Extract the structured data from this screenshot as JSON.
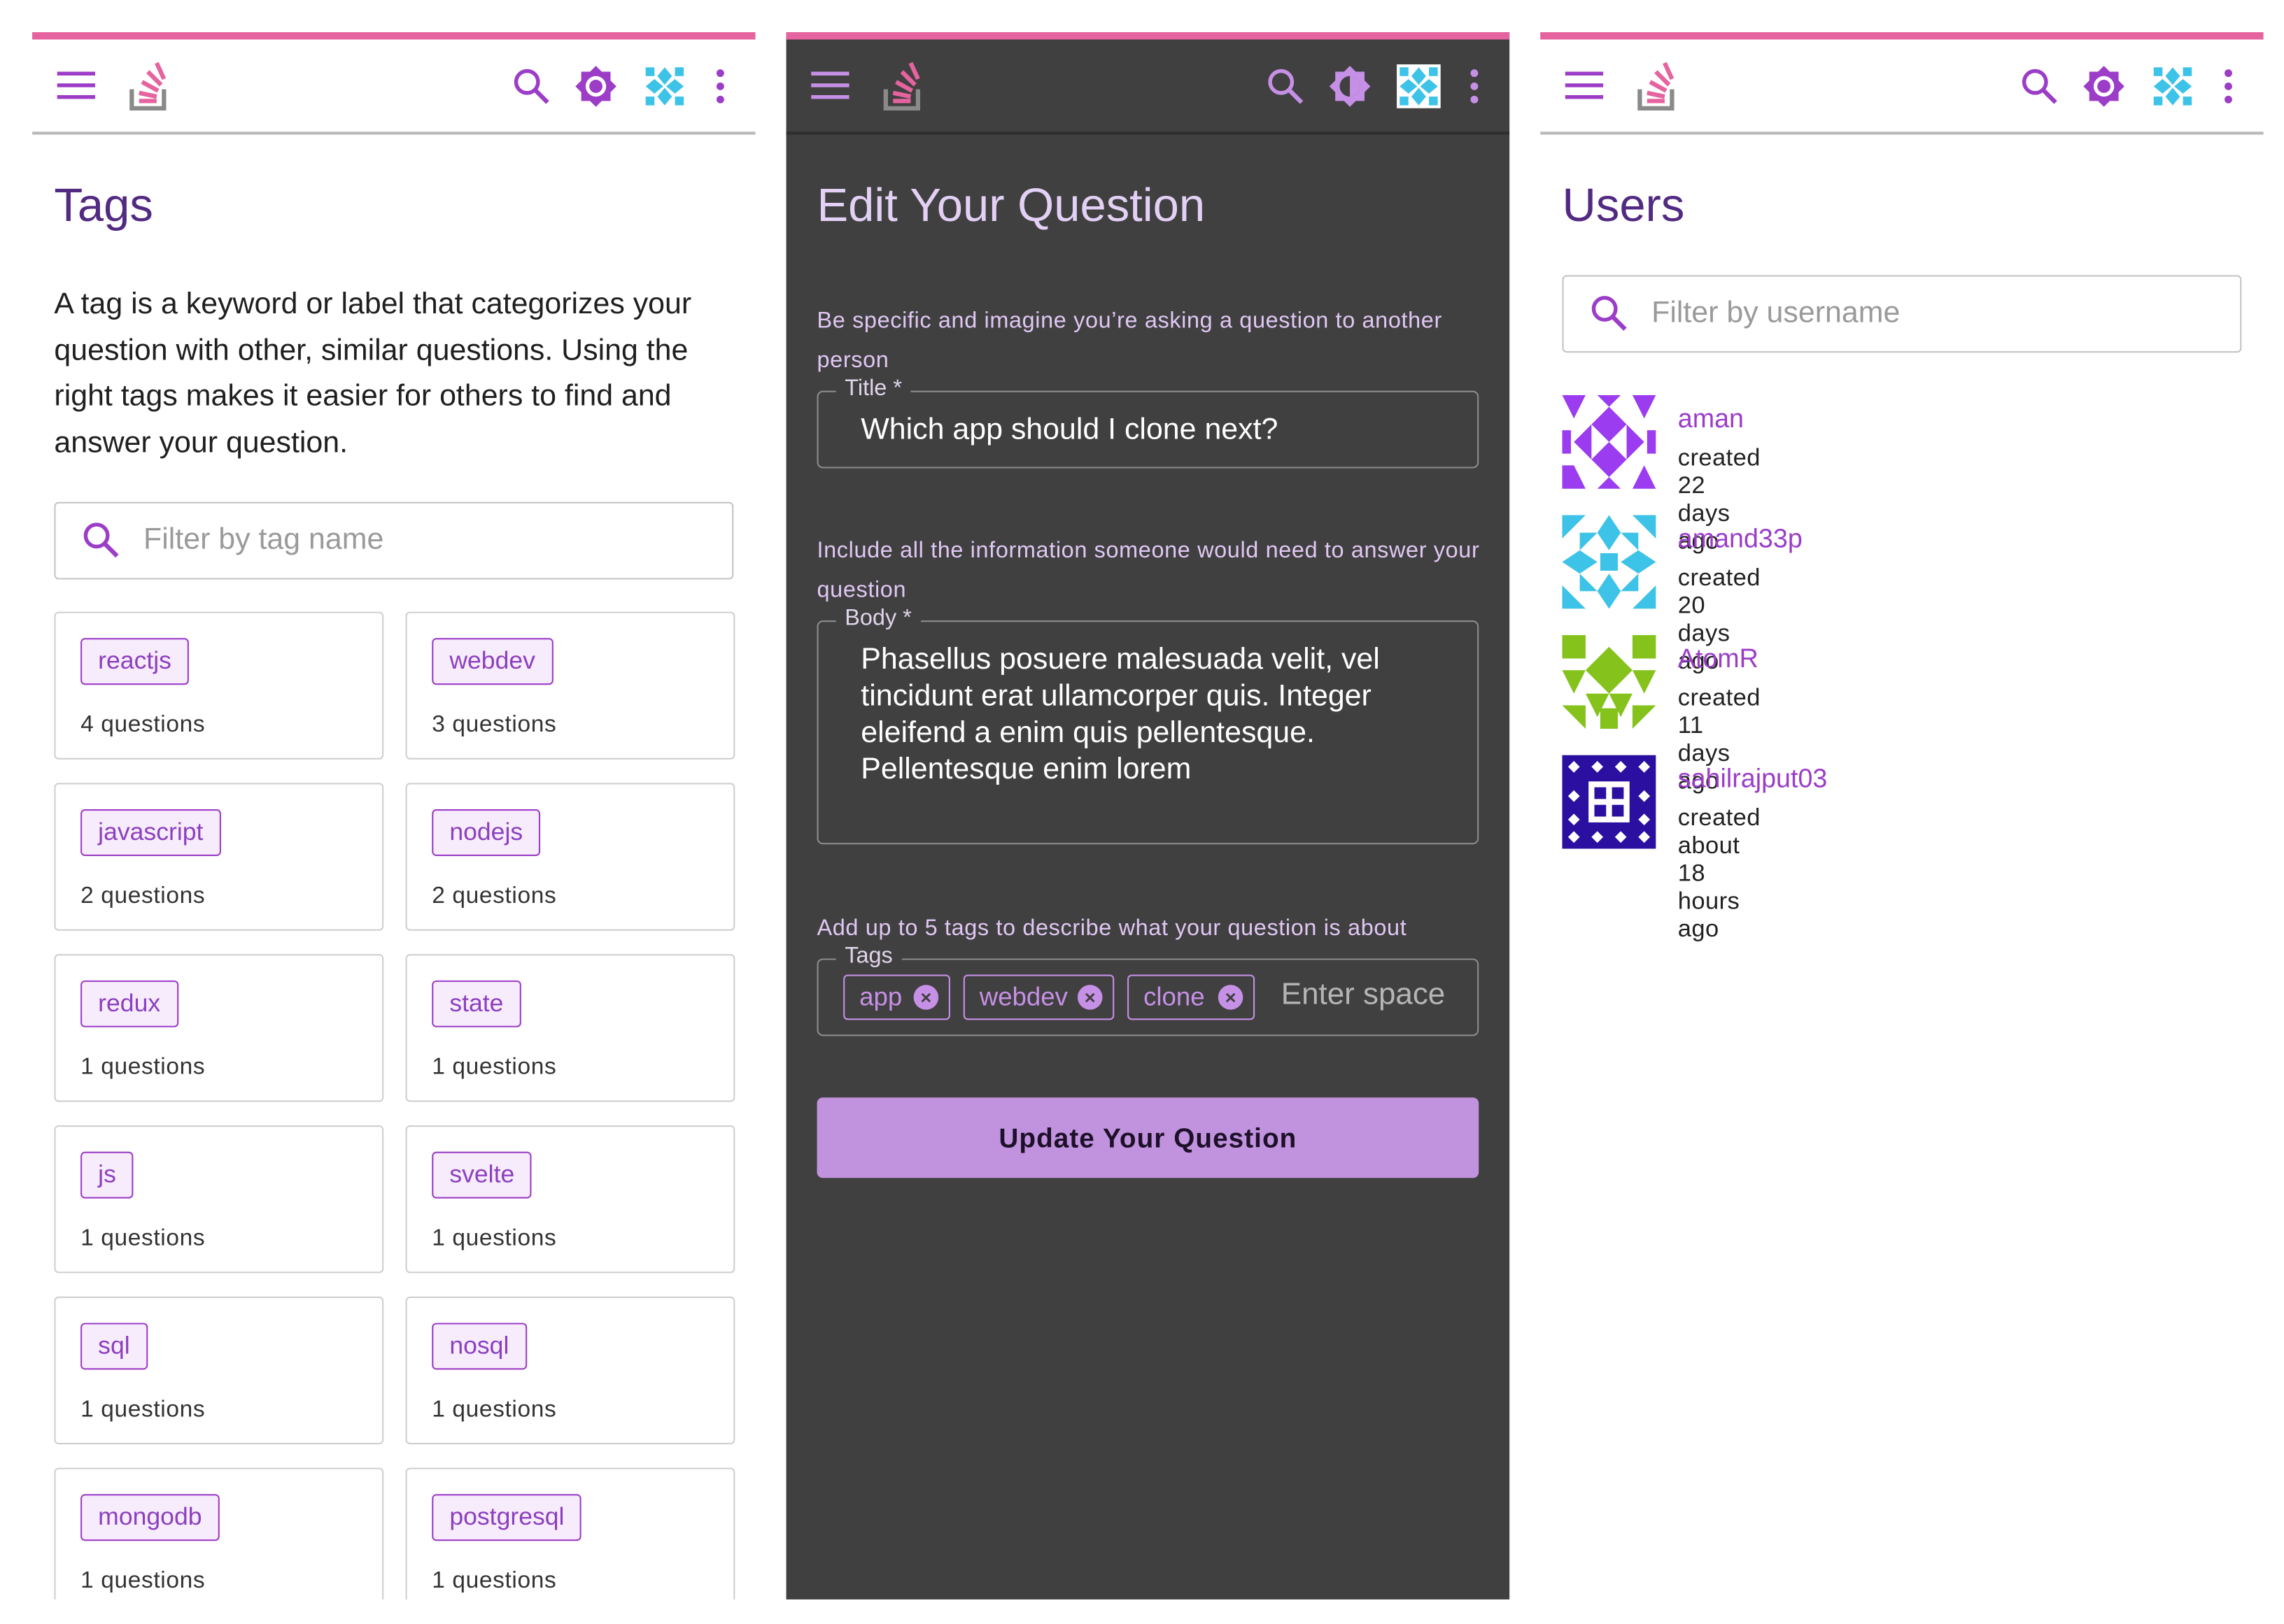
{
  "colors": {
    "accent": "#9c3dc8",
    "topbar_stripe": "#e5639e",
    "button": "#c193de",
    "dark_bg": "#404040"
  },
  "topbar": {
    "icons": [
      "menu-icon",
      "stackoverflow-logo",
      "search-icon",
      "theme-toggle-icon",
      "user-avatar",
      "more-vert-icon"
    ]
  },
  "tags_page": {
    "title": "Tags",
    "description": "A tag is a keyword or label that categorizes your question with other, similar questions. Using the right tags makes it easier for others to find and answer your question.",
    "search_placeholder": "Filter by tag name",
    "tags": [
      {
        "name": "reactjs",
        "count": "4 questions"
      },
      {
        "name": "webdev",
        "count": "3 questions"
      },
      {
        "name": "javascript",
        "count": "2 questions"
      },
      {
        "name": "nodejs",
        "count": "2 questions"
      },
      {
        "name": "redux",
        "count": "1 questions"
      },
      {
        "name": "state",
        "count": "1 questions"
      },
      {
        "name": "js",
        "count": "1 questions"
      },
      {
        "name": "svelte",
        "count": "1 questions"
      },
      {
        "name": "sql",
        "count": "1 questions"
      },
      {
        "name": "nosql",
        "count": "1 questions"
      },
      {
        "name": "mongodb",
        "count": "1 questions"
      },
      {
        "name": "postgresql",
        "count": "1 questions"
      }
    ]
  },
  "edit_page": {
    "title": "Edit Your Question",
    "title_hint": "Be specific and imagine you’re asking a question to another person",
    "title_label": "Title *",
    "title_value": "Which app should I clone next?",
    "body_hint": "Include all the information someone would need to answer your question",
    "body_label": "Body *",
    "body_value": "Phasellus posuere malesuada velit, vel tincidunt erat ullamcorper quis. Integer eleifend a enim quis pellentesque. Pellentesque enim lorem",
    "tags_hint": "Add up to 5 tags to describe what your question is about",
    "tags_label": "Tags",
    "tags": [
      "app",
      "webdev",
      "clone"
    ],
    "tags_placeholder": "Enter space",
    "submit_label": "Update Your Question"
  },
  "users_page": {
    "title": "Users",
    "search_placeholder": "Filter by username",
    "users": [
      {
        "username": "aman",
        "created": "created 22 days ago",
        "avatar_color": "#9b3cf0"
      },
      {
        "username": "amand33p",
        "created": "created 20 days ago",
        "avatar_color": "#3ec3e8"
      },
      {
        "username": "AtomR",
        "created": "created 11 days ago",
        "avatar_color": "#86c21c"
      },
      {
        "username": "sahilrajput03",
        "created": "created about 18 hours ago",
        "avatar_color": "#2a0fa0"
      }
    ]
  }
}
